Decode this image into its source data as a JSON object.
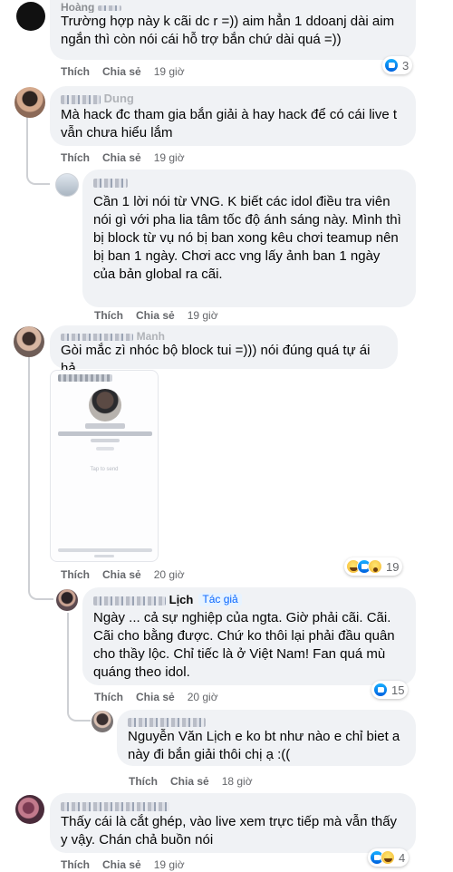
{
  "comments": [
    {
      "author": "Hoàng",
      "text": "Trường hợp này k cãi dc r =)) aim hẳn 1 ddoanj dài aim ngắn thì còn nói cái hỗ trợ bắn chứ dài quá =))",
      "like": "Thích",
      "reply": "Chia sẻ",
      "time": "19 giờ",
      "reactions": "3"
    },
    {
      "author": "Dung",
      "text": "Mà hack đc tham gia bắn giải à hay hack để có cái live t vẫn chưa hiểu lắm",
      "like": "Thích",
      "reply": "Chia sẻ",
      "time": "19 giờ"
    },
    {
      "author": "",
      "text": "Cần 1 lời nói từ VNG. K biết các idol điều tra viên nói gì với pha lia tâm tốc độ ánh sáng này. Mình thì bị block từ vụ nó bị ban xong kêu chơi teamup nên bị ban 1 ngày. Chơi acc vng lấy ảnh ban 1 ngày của bản global ra cãi.",
      "like": "Thích",
      "reply": "Chia sẻ",
      "time": "19 giờ"
    },
    {
      "author": "Manh",
      "text": "Gòi mắc zì nhóc bộ block tui =))) nói đúng quá tự ái hả",
      "like": "Thích",
      "reply": "Chia sẻ",
      "time": "20 giờ",
      "reactions": "19",
      "attachment": {
        "stats": "241K people like this including and 51 friends",
        "tap": "Tap to send"
      }
    },
    {
      "author": "Lịch",
      "badge": "Tác giả",
      "text": "Ngày ... cả sự nghiệp của ngta. Giờ phải cãi. Cãi. Cãi cho bằng được. Chứ ko thôi lại phải đầu quân cho thầy lộc. Chỉ tiếc là ở Việt Nam! Fan quá mù quáng theo idol.",
      "like": "Thích",
      "reply": "Chia sẻ",
      "time": "20 giờ",
      "reactions": "15"
    },
    {
      "author": "",
      "text": "Nguyễn Văn Lịch e ko bt như nào e chỉ biet a này đi bắn giải thôi chị ạ :((",
      "like": "Thích",
      "reply": "Chia sẻ",
      "time": "18 giờ"
    },
    {
      "author": "",
      "text": "Thấy cái là cắt ghép, vào live xem trực tiếp mà vẫn thấy y vậy. Chán chả buồn nói",
      "like": "Thích",
      "reply": "Chia sẻ",
      "time": "19 giờ",
      "reactions": "4"
    }
  ],
  "icons": {
    "like": "like-reaction-icon",
    "haha": "haha-reaction-icon",
    "wow": "wow-reaction-icon"
  },
  "colors": {
    "bubble": "#f0f2f5",
    "secondary_text": "#65676b",
    "author_badge": "#0866ff"
  }
}
